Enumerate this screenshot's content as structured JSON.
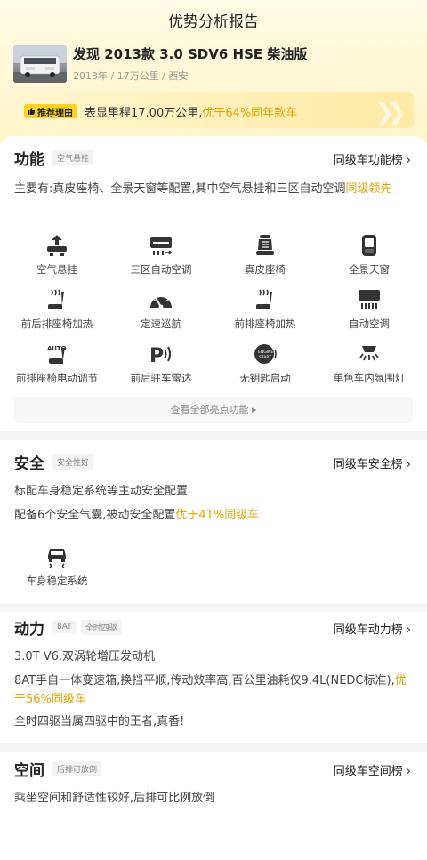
{
  "page": {
    "title": "优势分析报告"
  },
  "car": {
    "name": "发现 2013款 3.0 SDV6 HSE 柴油版",
    "meta": "2013年 / 17万公里 / 西安"
  },
  "reason": {
    "tag": "推荐理由",
    "text_plain": "表显里程17.00万公里,",
    "text_highlight": "优于64%同年款车"
  },
  "features": {
    "title": "功能",
    "tag": "空气悬挂",
    "rank_link": "同级车功能榜",
    "desc_plain": "主要有:真皮座椅、全景天窗等配置,其中空气悬挂和三区自动空调",
    "desc_highlight": "同级领先",
    "items": [
      {
        "label": "空气悬挂",
        "icon": "air-suspension-icon"
      },
      {
        "label": "三区自动空调",
        "icon": "climate-control-icon"
      },
      {
        "label": "真皮座椅",
        "icon": "leather-seat-icon"
      },
      {
        "label": "全景天窗",
        "icon": "panoramic-sunroof-icon"
      },
      {
        "label": "前后排座椅加热",
        "icon": "seat-heating-icon"
      },
      {
        "label": "定速巡航",
        "icon": "cruise-control-icon"
      },
      {
        "label": "前排座椅加热",
        "icon": "front-seat-heating-icon"
      },
      {
        "label": "自动空调",
        "icon": "auto-ac-icon"
      },
      {
        "label": "前排座椅电动调节",
        "icon": "power-seat-icon"
      },
      {
        "label": "前后驻车雷达",
        "icon": "parking-radar-icon"
      },
      {
        "label": "无钥匙启动",
        "icon": "keyless-start-icon"
      },
      {
        "label": "单色车内氛围灯",
        "icon": "ambient-light-icon"
      }
    ],
    "more": "查看全部亮点功能 ▸"
  },
  "safety": {
    "title": "安全",
    "tag": "安全性好",
    "rank_link": "同级车安全榜",
    "line1": "标配车身稳定系统等主动安全配置",
    "line2_plain": "配备6个安全气囊,被动安全配置",
    "line2_highlight": "优于41%同级车",
    "item": {
      "label": "车身稳定系统",
      "icon": "stability-control-icon"
    }
  },
  "power": {
    "title": "动力",
    "tags": [
      "8AT",
      "全时四驱"
    ],
    "rank_link": "同级车动力榜",
    "line1": "3.0T V6,双涡轮增压发动机",
    "line2_plain": "8AT手自一体变速箱,换挡平顺,传动效率高,百公里油耗仅9.4L(NEDC标准),",
    "line2_highlight": "优于56%同级车",
    "line3": "全时四驱当属四驱中的王者,真香!"
  },
  "space": {
    "title": "空间",
    "tag": "后排可放倒",
    "rank_link": "同级车空间榜",
    "line1": "乘坐空间和舒适性较好,后排可比例放倒"
  },
  "colors": {
    "accent": "#e4a400",
    "tag_yellow": "#ffd21f"
  }
}
